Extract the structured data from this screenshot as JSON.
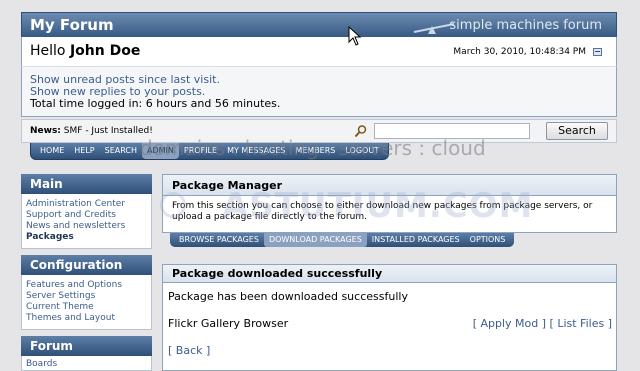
{
  "header": {
    "forum_name": "My Forum",
    "logo_text": "simple machines forum"
  },
  "user": {
    "greeting": "Hello",
    "name": "John Doe",
    "datetime": "March 30, 2010, 10:48:34 PM"
  },
  "info": {
    "unread_posts": "Show unread posts since last visit.",
    "new_replies": "Show new replies to your posts.",
    "time_logged": "Total time logged in: 6 hours and 56 minutes."
  },
  "news": {
    "label": "News:",
    "text": "SMF - Just Installed!"
  },
  "search": {
    "button": "Search",
    "value": ""
  },
  "mainnav": [
    "HOME",
    "HELP",
    "SEARCH",
    "ADMIN",
    "PROFILE",
    "MY MESSAGES",
    "MEMBERS",
    "LOGOUT"
  ],
  "watermark": {
    "line1": "domains : hosting : servers : cloud",
    "line2": "ASTUTIUM.COM"
  },
  "sidebar": {
    "main": {
      "title": "Main",
      "links": [
        "Administration Center",
        "Support and Credits",
        "News and newsletters",
        "Packages"
      ]
    },
    "configuration": {
      "title": "Configuration",
      "links": [
        "Features and Options",
        "Server Settings",
        "Current Theme",
        "Themes and Layout"
      ]
    },
    "forum": {
      "title": "Forum",
      "links": [
        "Boards"
      ]
    }
  },
  "package_manager": {
    "title": "Package Manager",
    "description": "From this section you can choose to either download new packages from package servers, or upload a package file directly to the forum.",
    "tabs": [
      "BROWSE PACKAGES",
      "DOWNLOAD PACKAGES",
      "INSTALLED PACKAGES",
      "OPTIONS"
    ]
  },
  "result": {
    "title": "Package downloaded successfully",
    "message": "Package has been downloaded successfully",
    "package_name": "Flickr Gallery Browser",
    "apply_mod": "[ Apply Mod ]",
    "list_files": "[ List Files ]",
    "back": "[ Back ]"
  }
}
